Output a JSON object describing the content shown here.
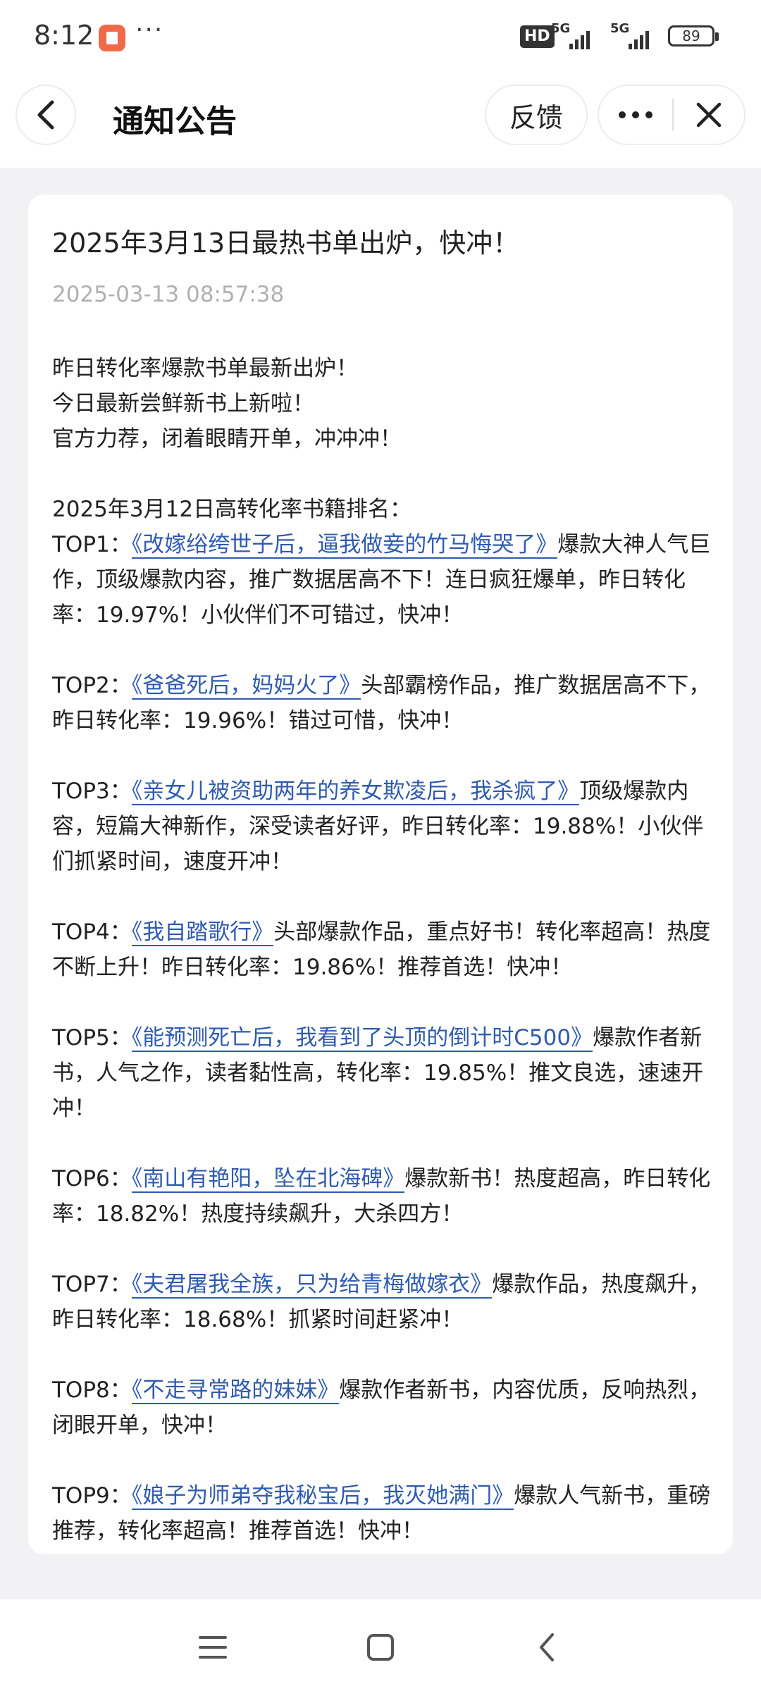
{
  "status_bar": {
    "time": "8:12",
    "dots": "···",
    "hd": "HD",
    "network_1": "5G",
    "network_2": "5G",
    "battery": "89"
  },
  "nav": {
    "title": "通知公告",
    "feedback_label": "反馈"
  },
  "article": {
    "title": "2025年3月13日最热书单出炉，快冲！",
    "time": "2025-03-13 08:57:38",
    "intro": [
      "昨日转化率爆款书单最新出炉！",
      "今日最新尝鲜新书上新啦！",
      "官方力荐，闭着眼睛开单，冲冲冲！"
    ],
    "ranking_heading": "2025年3月12日高转化率书籍排名：",
    "entries": [
      {
        "rank": "TOP1：",
        "book": "《改嫁绤绔世子后，逼我做妾的竹马悔哭了》",
        "desc": "爆款大神人气巨作，顶级爆款内容，推广数据居高不下！连日疯狂爆单，昨日转化率：19.97%！小伙伴们不可错过，快冲！"
      },
      {
        "rank": "TOP2：",
        "book": "《爸爸死后，妈妈火了》",
        "desc": "头部霸榜作品，推广数据居高不下，昨日转化率：19.96%！错过可惜，快冲！"
      },
      {
        "rank": "TOP3：",
        "book": "《亲女儿被资助两年的养女欺凌后，我杀疯了》",
        "desc": "顶级爆款内容，短篇大神新作，深受读者好评，昨日转化率：19.88%！小伙伴们抓紧时间，速度开冲！"
      },
      {
        "rank": "TOP4：",
        "book": "《我自踏歌行》",
        "desc": "头部爆款作品，重点好书！转化率超高！热度不断上升！昨日转化率：19.86%！推荐首选！快冲！"
      },
      {
        "rank": "TOP5：",
        "book": "《能预测死亡后，我看到了头顶的倒计时C500》",
        "desc": "爆款作者新书，人气之作，读者黏性高，转化率：19.85%！推文良选，速速开冲！"
      },
      {
        "rank": "TOP6：",
        "book": "《南山有艳阳，坠在北海碑》",
        "desc": "爆款新书！热度超高，昨日转化率：18.82%！热度持续飙升，大杀四方！"
      },
      {
        "rank": "TOP7：",
        "book": "《夫君屠我全族，只为给青梅做嫁衣》",
        "desc": "爆款作品，热度飙升，昨日转化率：18.68%！抓紧时间赶紧冲！"
      },
      {
        "rank": "TOP8：",
        "book": "《不走寻常路的妹妹》",
        "desc": "爆款作者新书，内容优质，反响热烈，闭眼开单，快冲！"
      },
      {
        "rank": "TOP9：",
        "book": "《娘子为师弟夺我秘宝后，我灭她满门》",
        "desc": "爆款人气新书，重磅推荐，转化率超高！推荐首选！快冲！"
      }
    ]
  },
  "icons": {
    "back": "chevron-left-icon",
    "more": "more-horizontal-icon",
    "close": "close-icon",
    "menu": "menu-icon",
    "home": "home-square-icon",
    "system_back": "system-back-icon"
  }
}
